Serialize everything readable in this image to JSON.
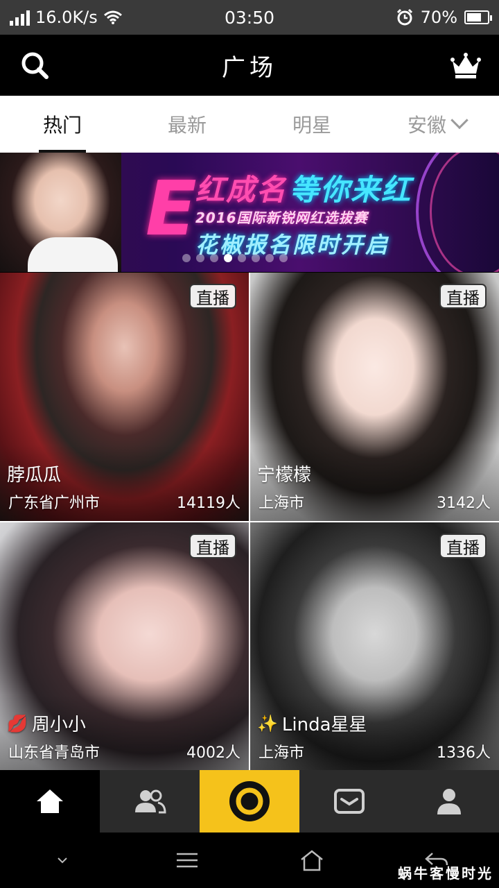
{
  "status_bar": {
    "net_speed": "16.0K/s",
    "time": "03:50",
    "battery": "70%",
    "battery_level": 0.7
  },
  "header": {
    "title": "广场"
  },
  "tabs": [
    {
      "label": "热门",
      "active": true
    },
    {
      "label": "最新",
      "active": false
    },
    {
      "label": "明星",
      "active": false
    },
    {
      "label": "安徽",
      "active": false
    }
  ],
  "banner": {
    "logo": "E",
    "slogan_a": "红成名",
    "slogan_b": "等你来红",
    "line1": "2016国际新锐网红选拔赛",
    "line2": "花椒报名限时开启",
    "slide_count": 8,
    "active_slide": 4
  },
  "live_badge": "直播",
  "cards": [
    {
      "name": "脖瓜瓜",
      "location": "广东省广州市",
      "viewers": "14119人",
      "emoji": ""
    },
    {
      "name": "宁檬檬",
      "location": "上海市",
      "viewers": "3142人",
      "emoji": ""
    },
    {
      "name": "周小小",
      "location": "山东省青岛市",
      "viewers": "4002人",
      "emoji": "💋"
    },
    {
      "name": "Linda星星",
      "location": "上海市",
      "viewers": "1336人",
      "emoji": "✨"
    }
  ],
  "bottom_nav": [
    "home-icon",
    "friends-icon",
    "live-camera-icon",
    "message-icon",
    "profile-icon"
  ],
  "colors": {
    "accent": "#f5c21b",
    "nav_bg": "#2b2b2b",
    "header_bg": "#000000"
  },
  "watermark": "蜗牛客慢时光"
}
